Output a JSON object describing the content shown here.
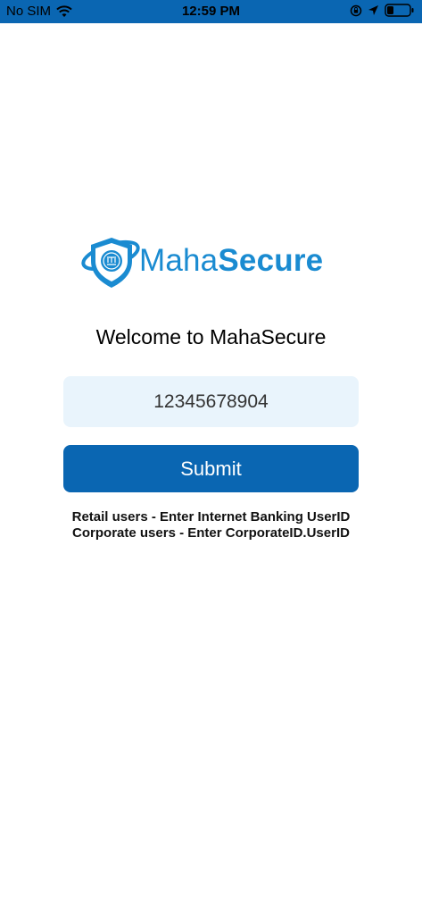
{
  "status_bar": {
    "carrier": "No SIM",
    "time": "12:59 PM"
  },
  "logo": {
    "text_light": "Maha",
    "text_bold": "Secure"
  },
  "welcome_text": "Welcome to MahaSecure",
  "user_id_input": {
    "value": "12345678904"
  },
  "submit_label": "Submit",
  "hints": {
    "retail": "Retail users - Enter Internet Banking UserID",
    "corporate": "Corporate users - Enter CorporateID.UserID"
  },
  "colors": {
    "status_bar_bg": "#0a66b2",
    "primary_button": "#0a66b2",
    "input_bg": "#e9f4fc",
    "logo_blue": "#1a8bd1"
  }
}
